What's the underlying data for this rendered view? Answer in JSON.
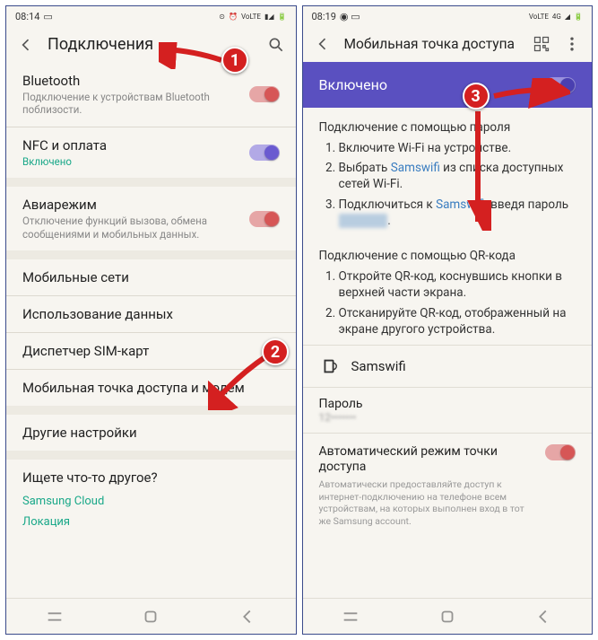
{
  "left": {
    "status_time": "08:14",
    "header_title": "Подключения",
    "bluetooth": {
      "title": "Bluetooth",
      "sub": "Подключение к устройствам Bluetooth поблизости."
    },
    "nfc": {
      "title": "NFC и оплата",
      "sub": "Включено"
    },
    "airplane": {
      "title": "Авиарежим",
      "sub": "Отключение функций вызова, обмена сообщениями и мобильных данных."
    },
    "mobile_networks": "Мобильные сети",
    "data_usage": "Использование данных",
    "sim_manager": "Диспетчер SIM-карт",
    "hotspot_modem": "Мобильная точка доступа и модем",
    "other_settings": "Другие настройки",
    "looking_for": "Ищете что-то другое?",
    "link_samsung_cloud": "Samsung Cloud",
    "link_location": "Локация"
  },
  "right": {
    "status_time": "08:19",
    "header_title": "Мобильная точка доступа",
    "banner_label": "Включено",
    "instr_pw_head": "Подключение с помощью пароля",
    "instr_pw_1a": "Включите Wi-Fi на устройстве.",
    "instr_pw_2a": "Выбрать ",
    "instr_pw_2_link": "Samswifi",
    "instr_pw_2b": " из списка доступных сетей Wi-Fi.",
    "instr_pw_3a": "Подключиться к ",
    "instr_pw_3_link": "Samswifi",
    "instr_pw_3b": ", введя пароль ",
    "instr_qr_head": "Подключение с помощью QR-кода",
    "instr_qr_1": "Откройте QR-код, коснувшись кнопки в верхней части экрана.",
    "instr_qr_2": "Отсканируйте QR-код, отображенный на экране другого устройства.",
    "ssid": "Samswifi",
    "pw_label": "Пароль",
    "pw_value": "12•••••••",
    "auto_title": "Автоматический режим точки доступа",
    "auto_sub": "Автоматически предоставляйте доступ к интернет-подключению на телефоне всем устройствам, на которых выполнен вход в тот же Samsung account."
  },
  "markers": {
    "m1": "1",
    "m2": "2",
    "m3": "3"
  }
}
